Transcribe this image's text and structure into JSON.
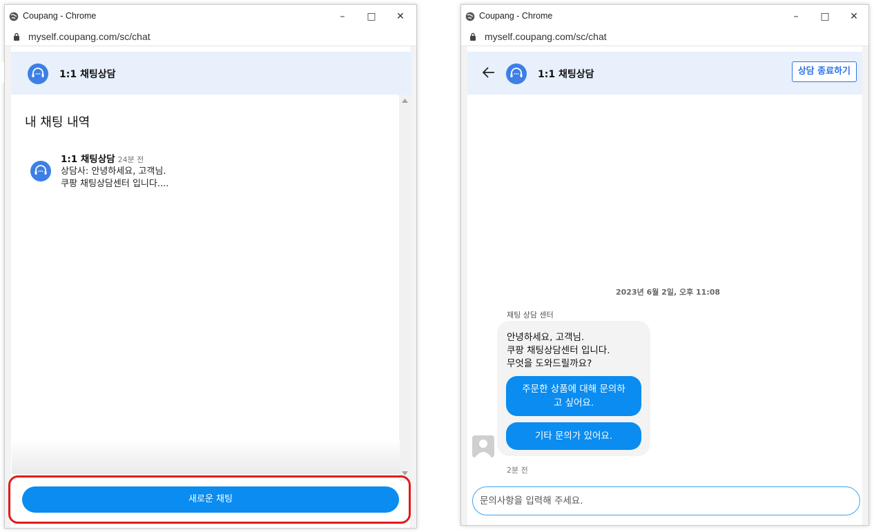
{
  "windows": {
    "title": "Coupang - Chrome",
    "url": "myself.coupang.com/sc/chat",
    "chat_title": "1:1 채팅상담"
  },
  "left": {
    "history_heading": "내 채팅 내역",
    "item": {
      "name": "1:1 채팅상담",
      "time": "24분 전",
      "line1": "상담사: 안녕하세요, 고객님.",
      "line2": "쿠팡 채팅상담센터 입니다...."
    },
    "new_chat_label": "새로운 채팅"
  },
  "right": {
    "end_label": "상담 종료하기",
    "timestamp": "2023년 6월 2일, 오후 11:08",
    "sender": "채팅 상담 센터",
    "message_lines": [
      "안녕하세요, 고객님.",
      "쿠팡 채팅상담센터 입니다.",
      "무엇을 도와드릴까요?"
    ],
    "option1_line1": "주문한 상품에 대해 문의하",
    "option1_line2": "고 싶어요.",
    "option2": "기타 문의가 있어요.",
    "ago": "2분 전",
    "input_placeholder": "문의사항을 입력해 주세요."
  },
  "colors": {
    "accent": "#0a8cf0",
    "header_bg": "#e8f0fc",
    "icon_blue": "#3d7fe6",
    "highlight": "#e21a1a"
  }
}
